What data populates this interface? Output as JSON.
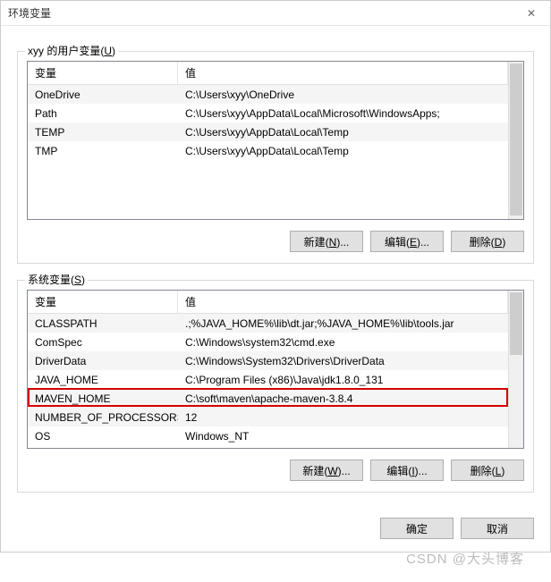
{
  "window": {
    "title": "环境变量",
    "close_glyph": "✕"
  },
  "user_section": {
    "label_prefix": "xyy 的用户变量(",
    "label_mn": "U",
    "label_suffix": ")",
    "headers": {
      "name": "变量",
      "value": "值"
    },
    "rows": [
      {
        "name": "OneDrive",
        "value": "C:\\Users\\xyy\\OneDrive"
      },
      {
        "name": "Path",
        "value": "C:\\Users\\xyy\\AppData\\Local\\Microsoft\\WindowsApps;"
      },
      {
        "name": "TEMP",
        "value": "C:\\Users\\xyy\\AppData\\Local\\Temp"
      },
      {
        "name": "TMP",
        "value": "C:\\Users\\xyy\\AppData\\Local\\Temp"
      }
    ],
    "buttons": {
      "new_pre": "新建(",
      "new_mn": "N",
      "new_post": ")...",
      "edit_pre": "编辑(",
      "edit_mn": "E",
      "edit_post": ")...",
      "del_pre": "删除(",
      "del_mn": "D",
      "del_post": ")"
    }
  },
  "system_section": {
    "label_prefix": "系统变量(",
    "label_mn": "S",
    "label_suffix": ")",
    "headers": {
      "name": "变量",
      "value": "值"
    },
    "rows": [
      {
        "name": "CLASSPATH",
        "value": ".;%JAVA_HOME%\\lib\\dt.jar;%JAVA_HOME%\\lib\\tools.jar"
      },
      {
        "name": "ComSpec",
        "value": "C:\\Windows\\system32\\cmd.exe"
      },
      {
        "name": "DriverData",
        "value": "C:\\Windows\\System32\\Drivers\\DriverData"
      },
      {
        "name": "JAVA_HOME",
        "value": "C:\\Program Files (x86)\\Java\\jdk1.8.0_131"
      },
      {
        "name": "MAVEN_HOME",
        "value": "C:\\soft\\maven\\apache-maven-3.8.4"
      },
      {
        "name": "NUMBER_OF_PROCESSORS",
        "value": "12"
      },
      {
        "name": "OS",
        "value": "Windows_NT"
      }
    ],
    "highlight_index": 4,
    "buttons": {
      "new_pre": "新建(",
      "new_mn": "W",
      "new_post": ")...",
      "edit_pre": "编辑(",
      "edit_mn": "I",
      "edit_post": ")...",
      "del_pre": "删除(",
      "del_mn": "L",
      "del_post": ")"
    }
  },
  "dialog_buttons": {
    "ok": "确定",
    "cancel": "取消"
  },
  "watermark": "CSDN @大头博客"
}
